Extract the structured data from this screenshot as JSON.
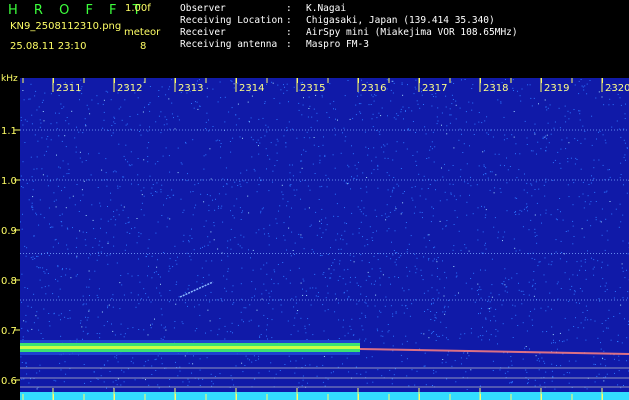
{
  "header": {
    "app_name": "H R O F F T",
    "version": "1.00f",
    "filename": "KN9_2508112310.png",
    "datetime": "25.08.11 23:10",
    "meteor_label": "meteor",
    "meteor_count": "8",
    "info": [
      {
        "label": "Observer",
        "value": "K.Nagai"
      },
      {
        "label": "Receiving Location",
        "value": "Chigasaki, Japan (139.414 35.340)"
      },
      {
        "label": "Receiver",
        "value": "AirSpy mini (Miakejima VOR 108.65MHz)"
      },
      {
        "label": "Receiving antenna",
        "value": "Maspro FM-3"
      }
    ]
  },
  "spectrogram": {
    "y_unit": "kHz",
    "y_ticks": [
      "1.1",
      "1.0",
      "0.9",
      "0.8",
      "0.7",
      "0.6"
    ],
    "x_ticks": [
      "2311",
      "2312",
      "2313",
      "2314",
      "2315",
      "2316",
      "2317",
      "2318",
      "2319",
      "2320"
    ],
    "colors": {
      "background": "#101aa8",
      "noise": "#2c74ff",
      "signal": "#40ff60",
      "signal_faint": "#ff8080",
      "bottom_band": "#33ddff",
      "tick_label": "#ffff66"
    }
  }
}
